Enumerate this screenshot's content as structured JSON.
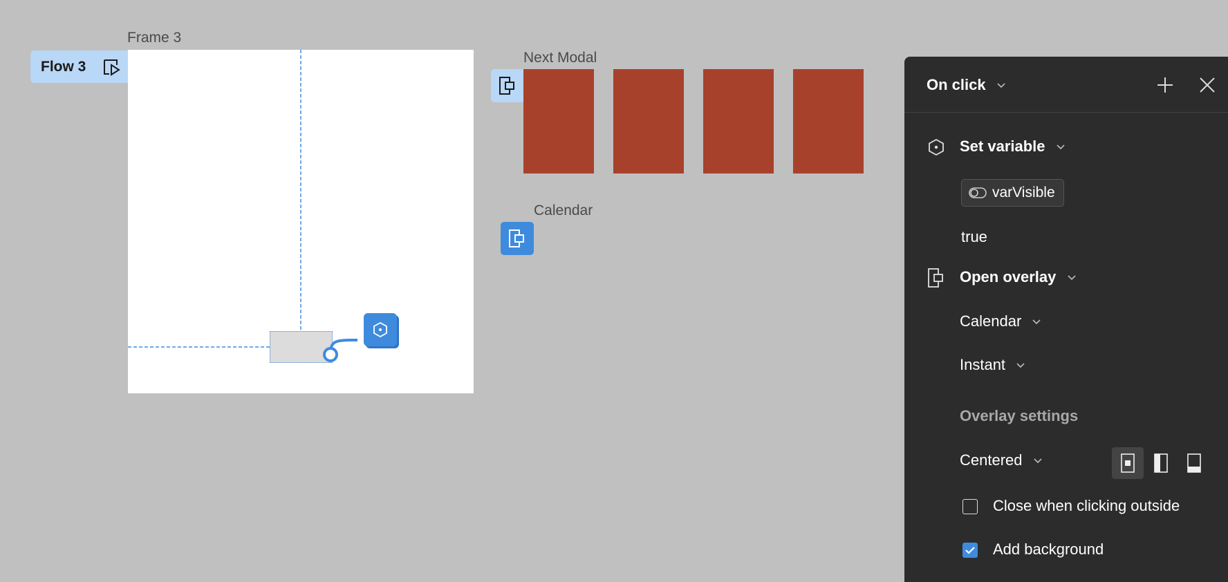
{
  "canvas": {
    "frame3_label": "Frame 3",
    "flow_label": "Flow 3",
    "next_modal_label": "Next Modal",
    "calendar_label": "Calendar",
    "card_color": "#a8412b",
    "accent": "#3e8bde"
  },
  "panel": {
    "trigger": "On click",
    "actions": [
      {
        "icon": "variable-hexagon-icon",
        "label": "Set variable",
        "variable": "varVisible",
        "value": "true"
      },
      {
        "icon": "overlay-icon",
        "label": "Open overlay",
        "destination": "Calendar",
        "animation": "Instant",
        "settings_heading": "Overlay settings",
        "position": "Centered",
        "close_when_clicking_outside": "Close when clicking outside",
        "close_when_clicking_outside_checked": false,
        "add_background": "Add background",
        "add_background_checked": true
      }
    ]
  }
}
